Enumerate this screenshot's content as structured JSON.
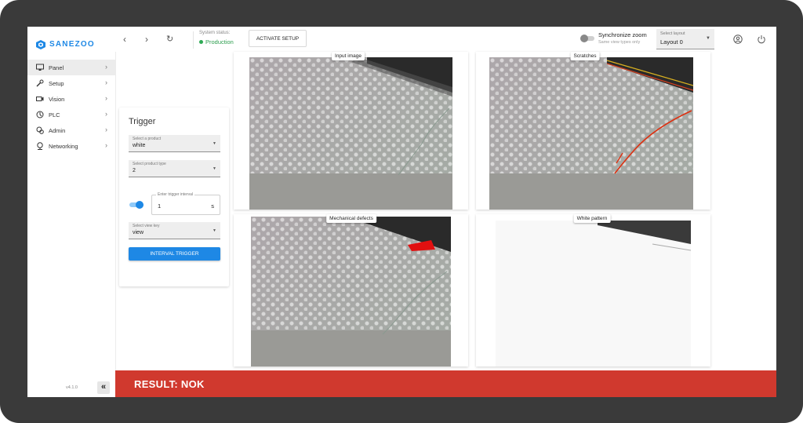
{
  "brand": {
    "name": "SANEZOO",
    "version": "v4.1.0",
    "accent": "#1e88e5"
  },
  "sidebar": {
    "items": [
      {
        "label": "Panel",
        "icon": "monitor-icon",
        "active": true
      },
      {
        "label": "Setup",
        "icon": "wrench-icon"
      },
      {
        "label": "Vision",
        "icon": "camera-icon"
      },
      {
        "label": "PLC",
        "icon": "plc-icon"
      },
      {
        "label": "Admin",
        "icon": "admin-icon"
      },
      {
        "label": "Networking",
        "icon": "network-icon"
      }
    ],
    "collapse_label": "«"
  },
  "topbar": {
    "status_label": "System status:",
    "status_value": "Production",
    "status_color": "#2eaa55",
    "activate_label": "ACTIVATE SETUP",
    "sync_title": "Synchronize zoom",
    "sync_sub": "Same view types only",
    "layout_label": "Select layout",
    "layout_value": "Layout 0"
  },
  "trigger": {
    "title": "Trigger",
    "product_label": "Select a product",
    "product_value": "white",
    "type_label": "Select product type",
    "type_value": "2",
    "interval_label": "Enter trigger interval",
    "interval_value": "1",
    "interval_unit": "s",
    "view_label": "Select view key",
    "view_value": "view",
    "button_label": "INTERVAL TRIGGER"
  },
  "views": [
    {
      "label": "Input image"
    },
    {
      "label": "Scratches"
    },
    {
      "label": "Mechanical defects"
    },
    {
      "label": "White pattern"
    }
  ],
  "result": {
    "text": "RESULT: NOK",
    "color": "#d0392e"
  }
}
